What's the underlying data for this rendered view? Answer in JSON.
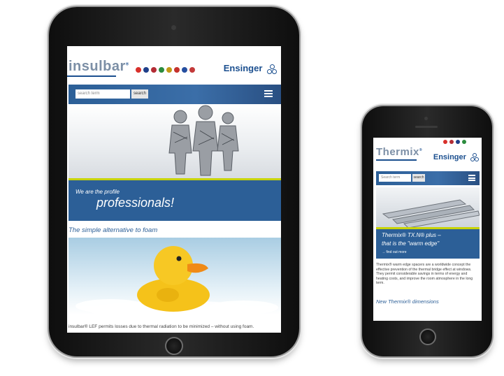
{
  "tablet": {
    "logo": "insulbar",
    "logo_reg": "®",
    "brand": "Ensinger",
    "search_placeholder": "search term",
    "search_button": "search",
    "banner_small": "We are the profile",
    "banner_big": "professionals!",
    "subhead": "The simple alternative to foam",
    "paragraph": "insulbar® LEF permits losses due to thermal radiation to be minimized – without using foam.",
    "flag_colors": [
      "#d8302b",
      "#1f3f8a",
      "#b32c35",
      "#2b8c3e",
      "#c29a16",
      "#c5322c",
      "#264fa0",
      "#c33a3a"
    ]
  },
  "phone": {
    "logo": "Thermix",
    "logo_reg": "®",
    "brand": "Ensinger",
    "search_placeholder": "Search term",
    "search_button": "search",
    "banner_line1": "Thermix® TX.N® plus –",
    "banner_line2": "that is the \"warm edge\"",
    "banner_link": "→ find out more",
    "paragraph": "Thermix® warm edge spacers are a worldwide concept the effective prevention of the thermal bridge effect at windows. They permit considerable savings in terms of energy and heating costs, and improve the room atmosphere in the long term.",
    "subhead": "New Thermix® dimensions",
    "flag_colors": [
      "#d8302b",
      "#b32c35",
      "#1f3f8a",
      "#2b8c3e"
    ]
  },
  "colors": {
    "brand_blue": "#2c5f97",
    "accent_yellow": "#c8d400"
  }
}
